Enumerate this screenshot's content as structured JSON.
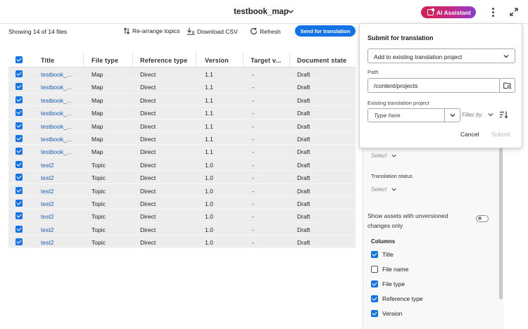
{
  "header": {
    "title": "testbook_map",
    "ai_assistant_label": "AI Assistant",
    "ai_color": "#d6204f"
  },
  "toolbar": {
    "showing": "Showing 14 of 14 files",
    "rearrange": "Re-arrange topics",
    "download": "Download CSV",
    "refresh": "Refresh",
    "send": "Send for translation",
    "accent": "#1473e6"
  },
  "table": {
    "columns": [
      "Title",
      "File type",
      "Reference type",
      "Version",
      "Target v...",
      "Document state"
    ],
    "rows": [
      {
        "title": "testbook_...",
        "file_type": "Map",
        "ref_type": "Direct",
        "version": "1.1",
        "target": "-",
        "state": "Draft"
      },
      {
        "title": "testbook_...",
        "file_type": "Map",
        "ref_type": "Direct",
        "version": "1.1",
        "target": "-",
        "state": "Draft"
      },
      {
        "title": "testbook_...",
        "file_type": "Map",
        "ref_type": "Direct",
        "version": "1.1",
        "target": "-",
        "state": "Draft"
      },
      {
        "title": "testbook_...",
        "file_type": "Map",
        "ref_type": "Direct",
        "version": "1.1",
        "target": "-",
        "state": "Draft"
      },
      {
        "title": "testbook_...",
        "file_type": "Map",
        "ref_type": "Direct",
        "version": "1.1",
        "target": "-",
        "state": "Draft"
      },
      {
        "title": "testbook_...",
        "file_type": "Map",
        "ref_type": "Direct",
        "version": "1.1",
        "target": "-",
        "state": "Draft"
      },
      {
        "title": "testbook_...",
        "file_type": "Map",
        "ref_type": "Direct",
        "version": "1.1",
        "target": "-",
        "state": "Draft"
      },
      {
        "title": "test2",
        "file_type": "Topic",
        "ref_type": "Direct",
        "version": "1.0",
        "target": "-",
        "state": "Draft"
      },
      {
        "title": "test2",
        "file_type": "Topic",
        "ref_type": "Direct",
        "version": "1.0",
        "target": "-",
        "state": "Draft"
      },
      {
        "title": "test2",
        "file_type": "Topic",
        "ref_type": "Direct",
        "version": "1.0",
        "target": "-",
        "state": "Draft"
      },
      {
        "title": "test2",
        "file_type": "Topic",
        "ref_type": "Direct",
        "version": "1.0",
        "target": "-",
        "state": "Draft"
      },
      {
        "title": "test2",
        "file_type": "Topic",
        "ref_type": "Direct",
        "version": "1.0",
        "target": "-",
        "state": "Draft"
      },
      {
        "title": "test2",
        "file_type": "Topic",
        "ref_type": "Direct",
        "version": "1.0",
        "target": "-",
        "state": "Draft"
      },
      {
        "title": "test2",
        "file_type": "Topic",
        "ref_type": "Direct",
        "version": "1.0",
        "target": "-",
        "state": "Draft"
      }
    ]
  },
  "popover": {
    "title": "Submit for translation",
    "mode_value": "Add to existing translation project",
    "path_label": "Path",
    "path_value": "/content/projects",
    "project_label": "Existing translation project",
    "project_placeholder": "Type here",
    "filter_by": "Filter by",
    "cancel": "Cancel",
    "submit": "Submit"
  },
  "filters": {
    "select_placeholder_1": "Select",
    "translation_status_label": "Translation status",
    "select_placeholder_2": "Select",
    "unversioned_label_line1": "Show assets with unversioned",
    "unversioned_label_line2": "changes only",
    "columns_heading": "Columns",
    "column_options": [
      {
        "label": "Title",
        "checked": true
      },
      {
        "label": "File name",
        "checked": false
      },
      {
        "label": "File type",
        "checked": true
      },
      {
        "label": "Reference type",
        "checked": true
      },
      {
        "label": "Version",
        "checked": true
      }
    ]
  }
}
